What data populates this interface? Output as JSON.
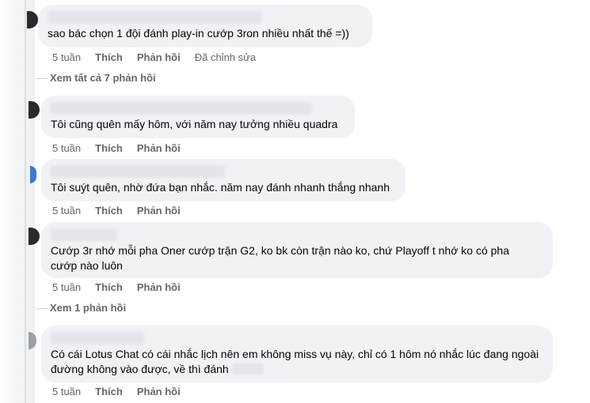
{
  "comments": [
    {
      "text": "sao bác chọn 1 đội đánh play-in cướp 3ron nhiều nhất thế =))",
      "time": "5 tuần",
      "like": "Thích",
      "reply": "Phản hồi",
      "edited": "Đã chỉnh sửa"
    },
    {
      "text": "Tôi cũng quên mấy hôm, với năm nay tưởng nhiều quadra",
      "time": "5 tuần",
      "like": "Thích",
      "reply": "Phản hồi"
    },
    {
      "text": "Tôi suýt quên, nhờ đứa bạn nhắc. năm nay đánh nhanh thắng nhanh",
      "time": "5 tuần",
      "like": "Thích",
      "reply": "Phản hồi"
    },
    {
      "text": "Cướp 3r nhớ mỗi pha Oner cướp trận G2, ko bk còn trận nào ko, chứ Playoff t nhớ ko có pha cướp nào luôn",
      "time": "5 tuần",
      "like": "Thích",
      "reply": "Phản hồi"
    },
    {
      "text": "Có cái Lotus Chat có cái nhắc lịch nên em không miss vụ này, chỉ có 1 hôm nó nhắc lúc đang ngoài đường không vào được, về thì đánh",
      "time": "5 tuần",
      "like": "Thích",
      "reply": "Phản hồi"
    }
  ],
  "view_replies": [
    "Xem tất cả 7 phản hồi",
    "Xem 1 phản hồi"
  ]
}
